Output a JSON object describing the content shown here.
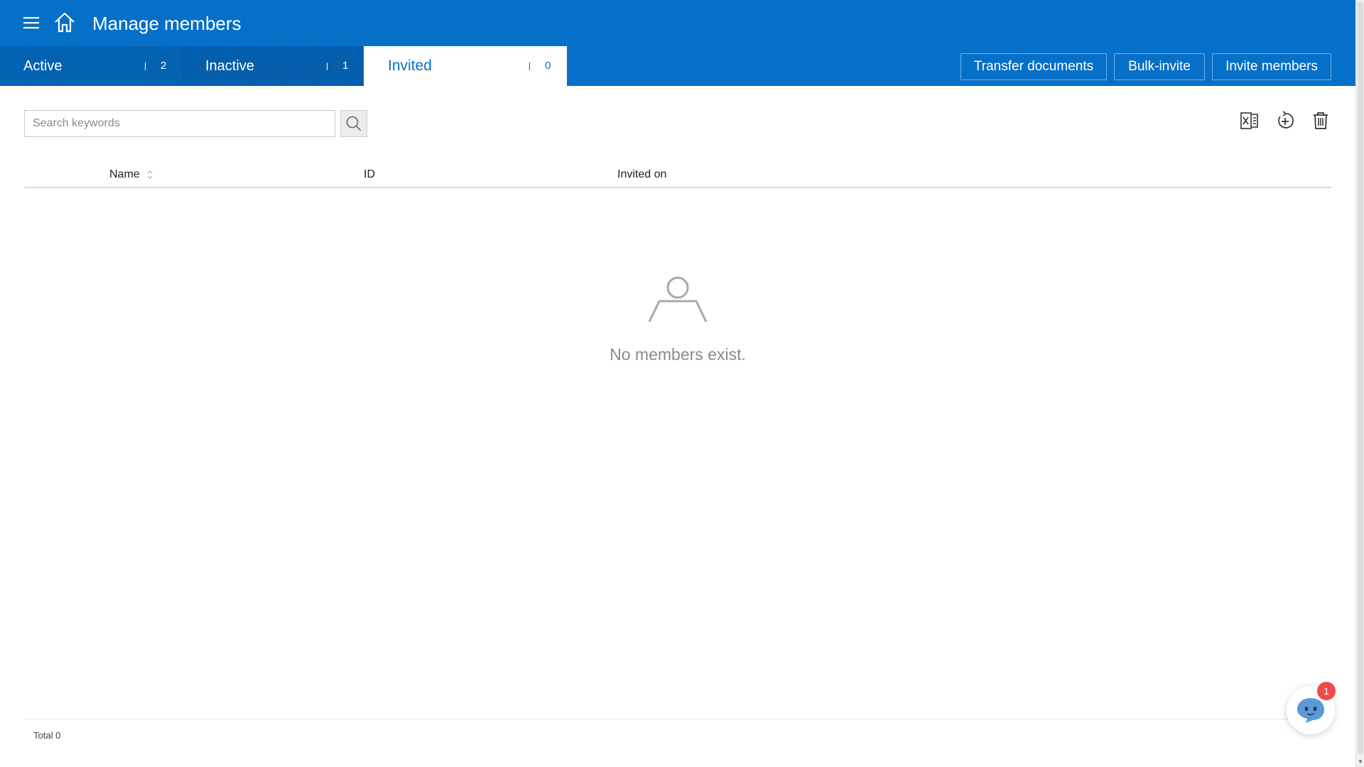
{
  "header": {
    "title": "Manage members",
    "menu_icon": "hamburger-menu-icon",
    "home_icon": "home-icon"
  },
  "tabs": [
    {
      "label": "Active",
      "count": "2",
      "selected": false
    },
    {
      "label": "Inactive",
      "count": "1",
      "selected": false
    },
    {
      "label": "Invited",
      "count": "0",
      "selected": true
    }
  ],
  "actions": {
    "transfer": "Transfer documents",
    "bulk_invite": "Bulk-invite",
    "invite": "Invite members"
  },
  "search": {
    "placeholder": "Search keywords",
    "value": ""
  },
  "toolbar_icons": [
    "excel-export-icon",
    "restore-icon",
    "trash-icon"
  ],
  "table": {
    "columns": [
      "Name",
      "ID",
      "Invited on"
    ],
    "rows": []
  },
  "empty_state": {
    "message": "No members exist."
  },
  "footer": {
    "total": "Total 0"
  },
  "chat": {
    "badge": "1"
  },
  "colors": {
    "brand": "#0670c8",
    "tab_dark": "#0462b3",
    "badge": "#ee4b4b",
    "muted_text": "#8a8a8a"
  }
}
